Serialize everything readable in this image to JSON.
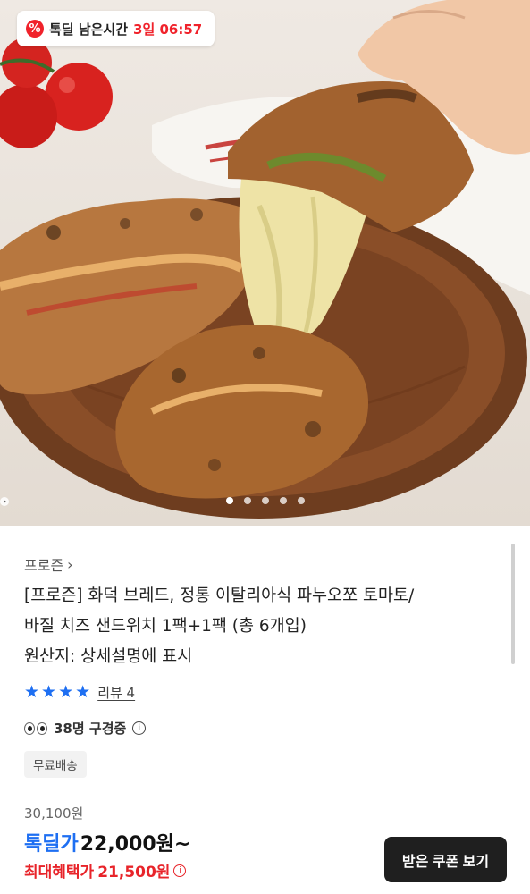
{
  "deal_timer": {
    "icon": "percent-icon",
    "icon_glyph": "%",
    "label": "톡딜 남은시간",
    "value": "3일 06:57",
    "accent_color": "#f0222b"
  },
  "hero": {
    "image_subject": "calzone-bread-cheese-pull-photo",
    "carousel": {
      "total": 6,
      "active_index": 0
    }
  },
  "product": {
    "breadcrumb": "프로즌",
    "title_line1": "[프로즌] 화덕 브레드, 정통 이탈리아식 파누오쪼 토마토/",
    "title_line2": "바질 치즈 샌드위치 1팩+1팩 (총 6개입)",
    "origin": "원산지: 상세설명에 표시",
    "rating": {
      "stars": 4,
      "max": 5,
      "color": "#1e6ff2"
    },
    "review_link": "리뷰 4",
    "viewers": "38명 구경중",
    "shipping_badge": "무료배송"
  },
  "price": {
    "original": "30,100원",
    "deal_label": "톡딜가",
    "deal_value": "22,000원~",
    "max_benefit_label": "최대혜택가",
    "max_benefit_value": "21,500원",
    "deal_color": "#1e6ff2",
    "benefit_color": "#e8242a"
  },
  "coupon_button": {
    "label": "받은 쿠폰 보기"
  }
}
